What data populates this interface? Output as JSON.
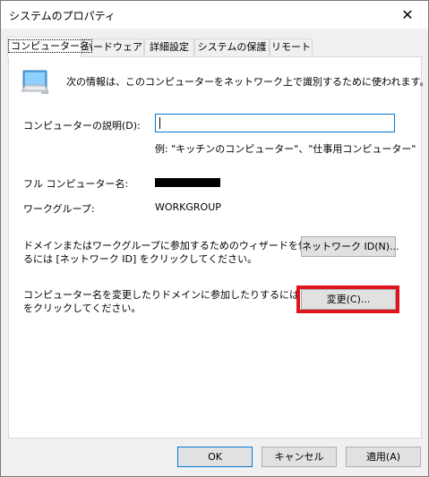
{
  "window": {
    "title": "システムのプロパティ",
    "close_glyph": "✕"
  },
  "tabs": [
    {
      "label": "コンピューター名",
      "active": true
    },
    {
      "label": "ハードウェア",
      "active": false
    },
    {
      "label": "詳細設定",
      "active": false
    },
    {
      "label": "システムの保護",
      "active": false
    },
    {
      "label": "リモート",
      "active": false
    }
  ],
  "computer_name_tab": {
    "icon": "computer-monitor-icon",
    "intro_text": "次の情報は、このコンピューターをネットワーク上で識別するために使われます。",
    "description_label": "コンピューターの説明(D):",
    "description_value": "",
    "description_example": "例: \"キッチンのコンピューター\"、\"仕事用コンピューター\"",
    "full_name_label": "フル コンピューター名:",
    "workgroup_label": "ワークグループ:",
    "workgroup_value": "WORKGROUP",
    "network_id_text_line1": "ドメインまたはワークグループに参加するためのウィザードを使用す",
    "network_id_text_line2": "るには [ネットワーク ID] をクリックしてください。",
    "network_id_button": "ネットワーク ID(N)...",
    "change_text_line1": "コンピューター名を変更したりドメインに参加したりするには [変更]",
    "change_text_line2": "をクリックしてください。",
    "change_button": "変更(C)..."
  },
  "footer": {
    "ok_button": "OK",
    "cancel_button": "キャンセル",
    "apply_button": "適用(A)"
  },
  "colors": {
    "highlight": "#e0141e",
    "focus_border": "#0078d7"
  }
}
